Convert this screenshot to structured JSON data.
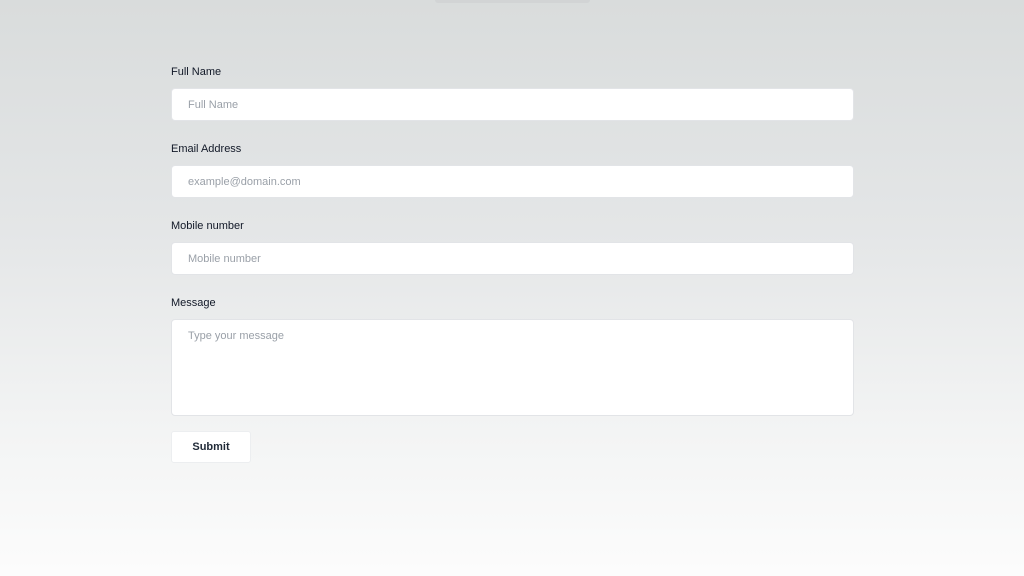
{
  "form": {
    "full_name": {
      "label": "Full Name",
      "placeholder": "Full Name",
      "value": ""
    },
    "email": {
      "label": "Email Address",
      "placeholder": "example@domain.com",
      "value": ""
    },
    "mobile": {
      "label": "Mobile number",
      "placeholder": "Mobile number",
      "value": ""
    },
    "message": {
      "label": "Message",
      "placeholder": "Type your message",
      "value": ""
    },
    "submit_label": "Submit"
  },
  "colors": {
    "input_background": "#ffffff",
    "input_border": "#e2e4e7",
    "placeholder_text": "#9aa0a8",
    "label_text": "#111827"
  }
}
